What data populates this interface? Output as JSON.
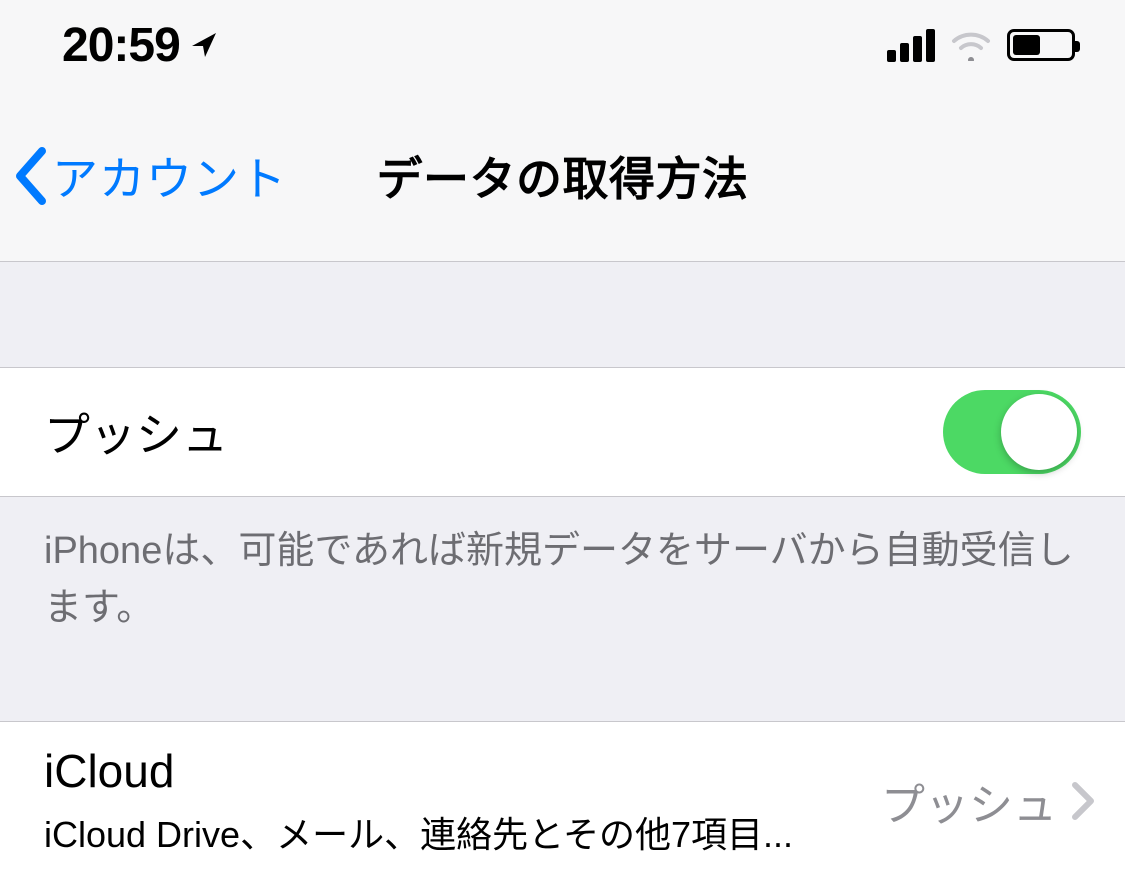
{
  "status": {
    "time": "20:59"
  },
  "nav": {
    "back": "アカウント",
    "title": "データの取得方法"
  },
  "push": {
    "label": "プッシュ",
    "footer": "iPhoneは、可能であれば新規データをサーバから自動受信します。",
    "on": true
  },
  "account": {
    "title": "iCloud",
    "subtitle": "iCloud Drive、メール、連絡先とその他7項目...",
    "value": "プッシュ"
  }
}
